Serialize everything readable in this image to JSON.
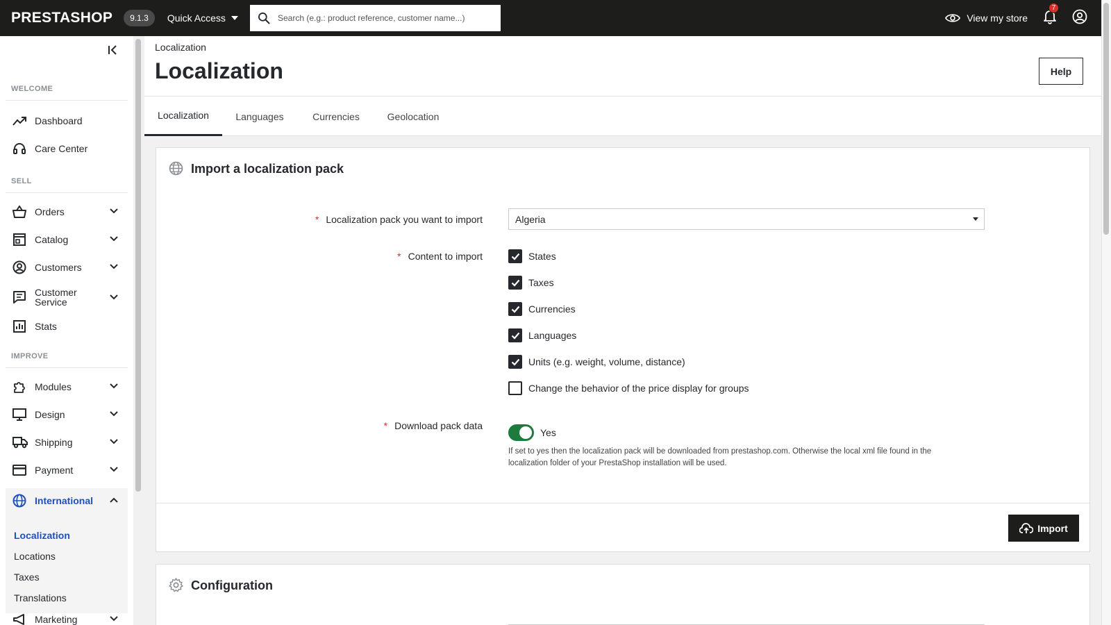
{
  "topbar": {
    "logo": "PRESTASHOP",
    "version": "9.1.3",
    "quick_access": "Quick Access",
    "search_placeholder": "Search (e.g.: product reference, customer name...)",
    "view_store": "View my store",
    "notifications_count": "7"
  },
  "sidebar": {
    "sections": {
      "welcome": "WELCOME",
      "sell": "SELL",
      "improve": "IMPROVE"
    },
    "items": {
      "dashboard": "Dashboard",
      "care_center": "Care Center",
      "orders": "Orders",
      "catalog": "Catalog",
      "customers": "Customers",
      "customer_service_1": "Customer",
      "customer_service_2": "Service",
      "stats": "Stats",
      "modules": "Modules",
      "design": "Design",
      "shipping": "Shipping",
      "payment": "Payment",
      "international": "International",
      "marketing": "Marketing"
    },
    "international_sub": {
      "localization": "Localization",
      "locations": "Locations",
      "taxes": "Taxes",
      "translations": "Translations"
    }
  },
  "header": {
    "breadcrumb": "Localization",
    "title": "Localization",
    "help": "Help"
  },
  "tabs": {
    "localization": "Localization",
    "languages": "Languages",
    "currencies": "Currencies",
    "geolocation": "Geolocation"
  },
  "import_card": {
    "title": "Import a localization pack",
    "pack_label": "Localization pack you want to import",
    "pack_value": "Algeria",
    "content_label": "Content to import",
    "options": {
      "states": "States",
      "taxes": "Taxes",
      "currencies": "Currencies",
      "languages": "Languages",
      "units": "Units (e.g. weight, volume, distance)",
      "price_display": "Change the behavior of the price display for groups"
    },
    "download_label": "Download pack data",
    "download_value": "Yes",
    "hint": "If set to yes then the localization pack will be downloaded from prestashop.com. Otherwise the local xml file found in the localization folder of your PrestaShop installation will be used.",
    "import_button": "Import"
  },
  "config_card": {
    "title": "Configuration"
  },
  "colors": {
    "topbar": "#1d1d1b",
    "active_nav": "#1d4fbf",
    "toggle_on": "#1f7a3d",
    "badge": "#d6312c"
  }
}
